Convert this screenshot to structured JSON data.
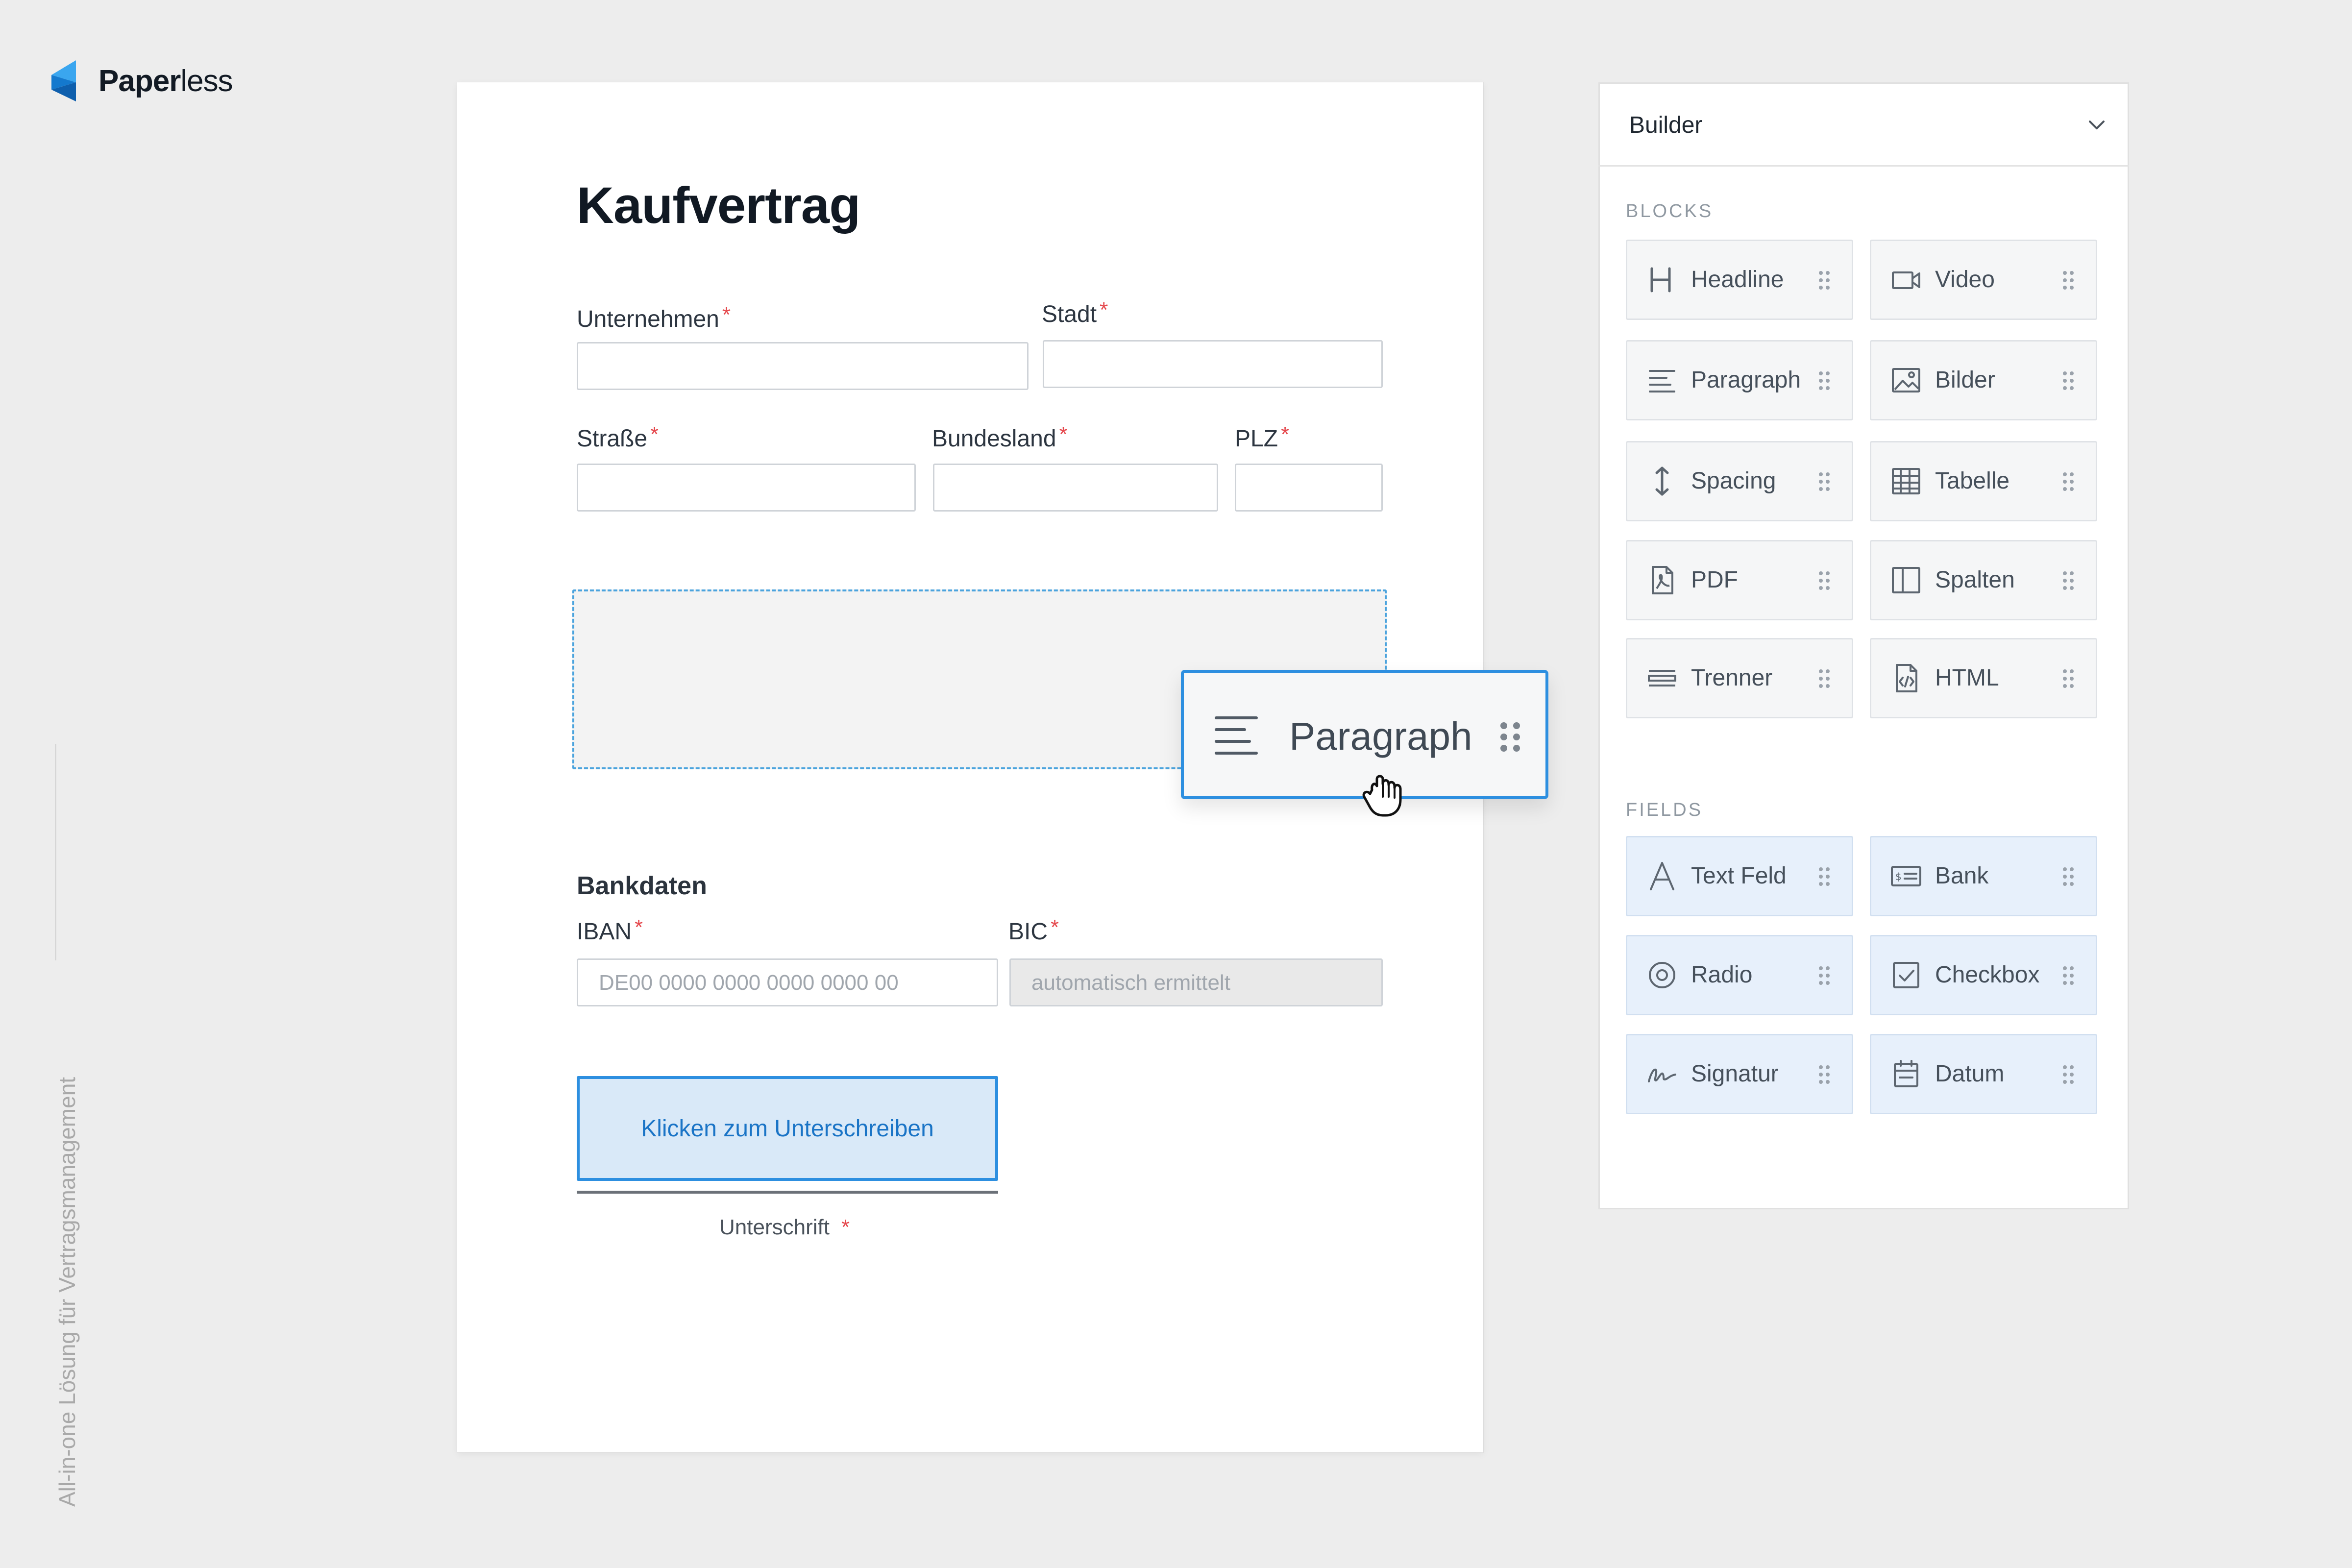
{
  "brand": {
    "name_bold": "Paper",
    "name_light": "less",
    "color": "#1479ce"
  },
  "tagline": "All-in-one Lösung für Vertragsmanagement",
  "document": {
    "title": "Kaufvertrag",
    "required_marker": "*",
    "fields": {
      "unternehmen": {
        "label": "Unternehmen",
        "value": ""
      },
      "stadt": {
        "label": "Stadt",
        "value": ""
      },
      "strasse": {
        "label": "Straße",
        "value": ""
      },
      "bundesland": {
        "label": "Bundesland",
        "value": ""
      },
      "plz": {
        "label": "PLZ",
        "value": ""
      }
    },
    "bank_section": {
      "heading": "Bankdaten",
      "iban": {
        "label": "IBAN",
        "placeholder": "DE00 0000 0000 0000 0000 00"
      },
      "bic": {
        "label": "BIC",
        "placeholder": "automatisch ermittelt",
        "disabled": true
      }
    },
    "signature": {
      "button": "Klicken zum Unterschreiben",
      "label": "Unterschrift"
    }
  },
  "drag_preview": {
    "label": "Paragraph",
    "icon": "paragraph-icon",
    "cursor": "grab-hand-icon",
    "accent": "#2d8fe0"
  },
  "builder": {
    "title": "Builder",
    "blocks_heading": "BLOCKS",
    "blocks": [
      {
        "label": "Headline",
        "icon": "headline-icon"
      },
      {
        "label": "Video",
        "icon": "video-icon"
      },
      {
        "label": "Paragraph",
        "icon": "paragraph-icon"
      },
      {
        "label": "Bilder",
        "icon": "image-icon"
      },
      {
        "label": "Spacing",
        "icon": "spacing-icon"
      },
      {
        "label": "Tabelle",
        "icon": "table-icon"
      },
      {
        "label": "PDF",
        "icon": "pdf-icon"
      },
      {
        "label": "Spalten",
        "icon": "columns-icon"
      },
      {
        "label": "Trenner",
        "icon": "divider-icon"
      },
      {
        "label": "HTML",
        "icon": "html-icon"
      }
    ],
    "fields_heading": "FIELDS",
    "fields": [
      {
        "label": "Text Feld",
        "icon": "text-field-icon"
      },
      {
        "label": "Bank",
        "icon": "bank-card-icon"
      },
      {
        "label": "Radio",
        "icon": "radio-icon"
      },
      {
        "label": "Checkbox",
        "icon": "checkbox-icon"
      },
      {
        "label": "Signatur",
        "icon": "signature-icon"
      },
      {
        "label": "Datum",
        "icon": "calendar-icon"
      }
    ]
  },
  "colors": {
    "background": "#ededed",
    "accent": "#2d8fe0",
    "required": "#e5484d",
    "field_tile": "#e7f0fb"
  }
}
